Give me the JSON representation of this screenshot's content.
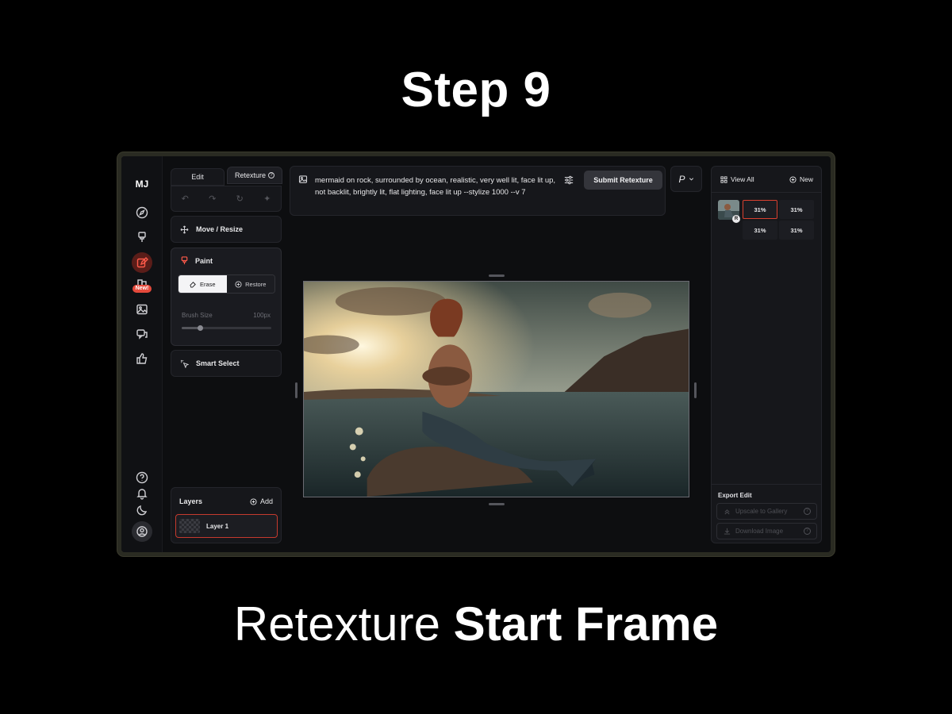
{
  "step_title": "Step 9",
  "caption": {
    "light": "Retexture",
    "bold": "Start Frame"
  },
  "rail": {
    "logo": "MJ",
    "new_badge": "New!"
  },
  "tabs": {
    "edit": "Edit",
    "retexture": "Retexture",
    "help": "?"
  },
  "tools": {
    "move_resize": "Move / Resize",
    "paint": "Paint",
    "erase": "Erase",
    "restore": "Restore",
    "brush_size_label": "Brush Size",
    "brush_size_value": "100px",
    "brush_size_fraction": 0.2,
    "smart_select": "Smart Select"
  },
  "layers": {
    "title": "Layers",
    "add": "Add",
    "items": [
      {
        "label": "Layer 1"
      }
    ]
  },
  "prompt": {
    "text": "mermaid on rock, surrounded by ocean, realistic, very well lit, face lit up, not backlit, brightly lit, flat lighting, face lit up --stylize 1000 --v 7",
    "submit": "Submit Retexture",
    "mode_button": "P"
  },
  "right_panel": {
    "view_all": "View All",
    "new": "New",
    "thumb_badge": "R",
    "grid": [
      "31%",
      "31%",
      "31%",
      "31%"
    ],
    "export_label": "Export Edit",
    "upscale": "Upscale to Gallery",
    "download": "Download Image",
    "help": "?"
  },
  "colors": {
    "accent": "#d8402f",
    "background": "#000000",
    "panel": "#16171b"
  }
}
